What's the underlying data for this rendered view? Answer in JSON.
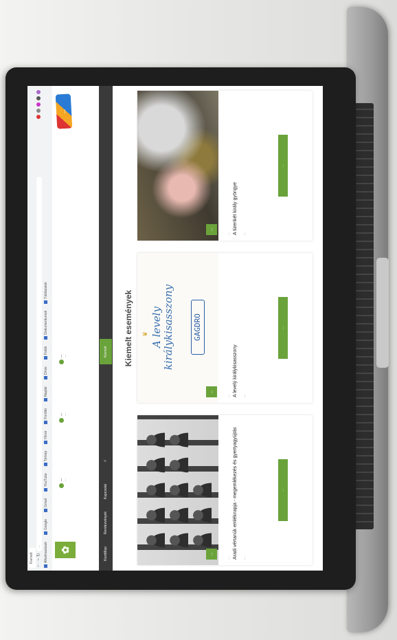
{
  "browser": {
    "tabs": [
      "Kiemelt"
    ],
    "address": "...",
    "bookmarks": [
      "Alkalmazások",
      "Google",
      "Gmail",
      "YouTube",
      "Térkép",
      "Hírek",
      "Fordító",
      "Naptár",
      "Drive",
      "Fotók",
      "Dokumentumok",
      "Táblázatok"
    ]
  },
  "site": {
    "contacts": [
      {
        "title": "...",
        "line": "..."
      },
      {
        "title": "...",
        "line": "..."
      },
      {
        "title": "...",
        "line": "..."
      }
    ],
    "partner_logo": "...",
    "nav": [
      "Kezdőlap",
      "Rendezvények",
      "Kapcsolat",
      "Kiemelt"
    ]
  },
  "main": {
    "section_title": "Kiemelt események",
    "cards": [
      {
        "date_badge": "...",
        "date_line": "...",
        "title": "Aradi vértanúk emléknapja - megemlékezés és gyertyagyújtás",
        "text": "...",
        "button": "..."
      },
      {
        "date_badge": "...",
        "poster_title": "A levely királykisasszony",
        "poster_stamp": "GAGDRO",
        "date_line": "...",
        "title": "A levelý királykisasszony",
        "text": "...",
        "button": "..."
      },
      {
        "date_badge": "...",
        "date_line": "...",
        "title": "A tizenkét király gyöngye",
        "text": "...",
        "button": "..."
      }
    ]
  }
}
